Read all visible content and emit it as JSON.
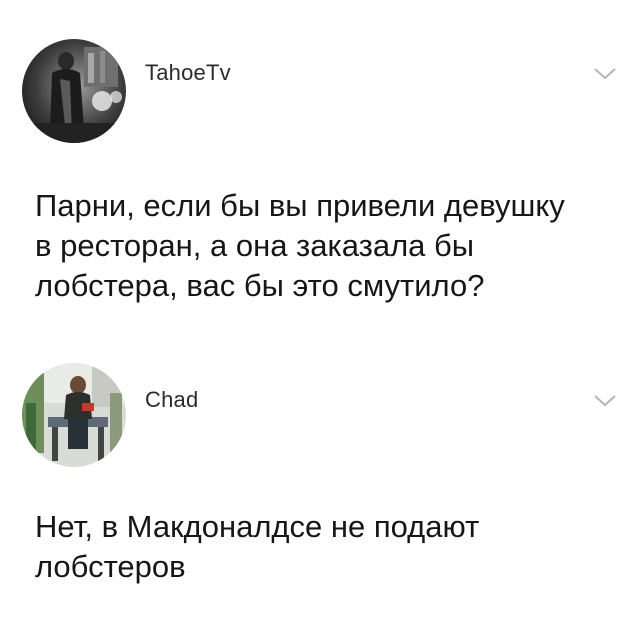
{
  "posts": [
    {
      "author": "TahoeTv",
      "avatar_icon": "avatar-photo-icon",
      "menu_icon": "chevron-down-icon",
      "text": "Парни, если бы вы привели девушку\nв ресторан, а она заказала бы\nлобстера, вас бы это смутило?"
    },
    {
      "author": "Chad",
      "avatar_icon": "avatar-photo-icon",
      "menu_icon": "chevron-down-icon",
      "text": "Нет, в Макдоналдсе не подают\nлобстеров"
    }
  ],
  "colors": {
    "background": "#ffffff",
    "text": "#161616",
    "author": "#2b2b2b",
    "chevron": "#b5b5b5"
  }
}
